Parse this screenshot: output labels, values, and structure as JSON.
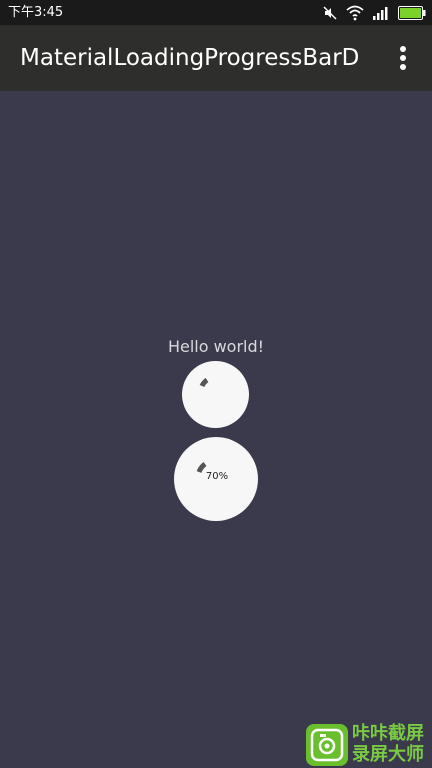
{
  "status_bar": {
    "time": "下午3:45",
    "icons": [
      "mute-icon",
      "wifi-icon",
      "signal-icon",
      "battery-icon"
    ],
    "battery_color": "#7bd22a"
  },
  "app_bar": {
    "title": "MaterialLoadingProgressBarD.",
    "menu_icon": "overflow-menu-icon"
  },
  "content": {
    "hello_text": "Hello world!",
    "progress_circles": [
      {
        "label": ""
      },
      {
        "label": "70%"
      }
    ]
  },
  "watermark": {
    "line1": "咔咔截屏",
    "line2": "录屏大师",
    "icon": "camera-icon"
  },
  "colors": {
    "background": "#3a3a4c",
    "app_bar": "#2e2e2c",
    "status_bar": "#1a1a1a",
    "circle": "#f7f7f7",
    "spinner": "#555555"
  }
}
